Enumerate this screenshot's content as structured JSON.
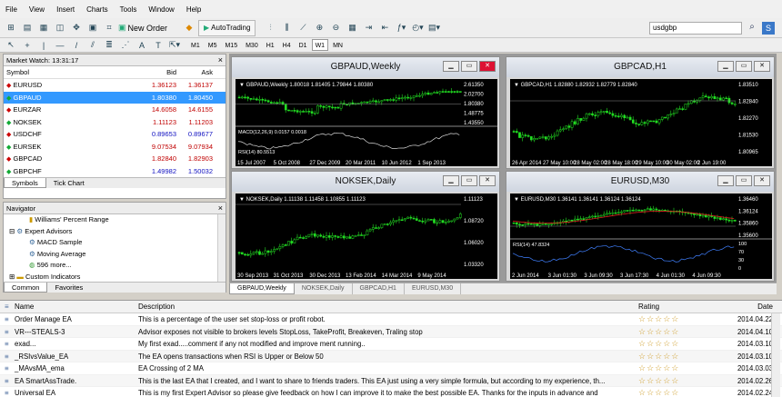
{
  "menu": [
    "File",
    "View",
    "Insert",
    "Charts",
    "Tools",
    "Window",
    "Help"
  ],
  "toolbar": {
    "new_order": "New Order",
    "autotrading": "AutoTrading",
    "search_value": "usdgbp"
  },
  "timeframes": [
    "M1",
    "M5",
    "M15",
    "M30",
    "H1",
    "H4",
    "D1",
    "W1",
    "MN"
  ],
  "market_watch": {
    "title": "Market Watch: 13:31:17",
    "cols": {
      "symbol": "Symbol",
      "bid": "Bid",
      "ask": "Ask"
    },
    "rows": [
      {
        "symbol": "EURUSD",
        "bid": "1.36123",
        "ask": "1.36137"
      },
      {
        "symbol": "GBPAUD",
        "bid": "1.80380",
        "ask": "1.80450"
      },
      {
        "symbol": "EURZAR",
        "bid": "14.6058",
        "ask": "14.6155"
      },
      {
        "symbol": "NOKSEK",
        "bid": "1.11123",
        "ask": "1.11203"
      },
      {
        "symbol": "USDCHF",
        "bid": "0.89653",
        "ask": "0.89677"
      },
      {
        "symbol": "EURSEK",
        "bid": "9.07534",
        "ask": "9.07934"
      },
      {
        "symbol": "GBPCAD",
        "bid": "1.82840",
        "ask": "1.82903"
      },
      {
        "symbol": "GBPCHF",
        "bid": "1.49982",
        "ask": "1.50032"
      }
    ],
    "tabs": [
      "Symbols",
      "Tick Chart"
    ]
  },
  "navigator": {
    "title": "Navigator",
    "items": [
      "Williams' Percent Range",
      "Expert Advisors",
      "MACD Sample",
      "Moving Average",
      "596 more...",
      "Custom Indicators"
    ],
    "tabs": [
      "Common",
      "Favorites"
    ]
  },
  "charts": [
    {
      "title": "GBPAUD,Weekly",
      "info": "GBPAUD,Weekly  1.80018 1.81405 1.79844 1.80380",
      "prices": [
        "2.61350",
        "2.02700",
        "1.80380",
        "1.48775",
        "1.43550"
      ],
      "dates": [
        "15 Jul 2007",
        "5 Oct 2008",
        "27 Dec 2009",
        "20 Mar 2011",
        "10 Jun 2012",
        "1 Sep 2013"
      ],
      "sub1": "MACD(12,26,9) 0.0157  0.0018",
      "sub2": "RSI(14) 80.5513"
    },
    {
      "title": "GBPCAD,H1",
      "info": "GBPCAD,H1  1.82880 1.82932 1.82779 1.82840",
      "prices": [
        "1.83510",
        "1.82840",
        "1.82270",
        "1.81530",
        "1.80965"
      ],
      "dates": [
        "26 Apr 2014",
        "27 May 10:00",
        "28 May 02:00",
        "28 May 18:00",
        "29 May 10:00",
        "30 May 02:00",
        "2 Jun 19:00"
      ]
    },
    {
      "title": "NOKSEK,Daily",
      "info": "NOKSEK,Daily  1.11138 1.11458 1.10855 1.11123",
      "prices": [
        "1.11123",
        "1.08720",
        "1.06020",
        "1.03320"
      ],
      "dates": [
        "30 Sep 2013",
        "31 Oct 2013",
        "30 Dec 2013",
        "13 Feb 2014",
        "14 Mar 2014",
        "9 May 2014"
      ]
    },
    {
      "title": "EURUSD,M30",
      "info": "EURUSD,M30  1.36141 1.36141 1.36124 1.36124",
      "prices": [
        "1.36460",
        "1.36124",
        "1.35860",
        "1.35600"
      ],
      "sub": "RSI(14) 47.8324",
      "subprices": [
        "100",
        "70",
        "30",
        "0"
      ],
      "dates": [
        "2 Jun 2014",
        "3 Jun 01:30",
        "3 Jun 09:30",
        "3 Jun 17:30",
        "4 Jun 01:30",
        "4 Jun 09:30"
      ]
    }
  ],
  "chart_tabs": [
    "GBPAUD,Weekly",
    "NOKSEK,Daily",
    "GBPCAD,H1",
    "EURUSD,M30"
  ],
  "market": {
    "cols": {
      "name": "Name",
      "desc": "Description",
      "rating": "Rating",
      "date": "Date"
    },
    "rows": [
      {
        "name": "Order Manage EA",
        "desc": "This is a percentage of the user set stop-loss or profit robot.",
        "date": "2014.04.22"
      },
      {
        "name": "VR---STEALS-3",
        "desc": "Advisor exposes not visible to brokers levels StopLoss, TakeProfit, Breakeven, Traling stop",
        "date": "2014.04.10"
      },
      {
        "name": "exad...",
        "desc": "My first exad.....comment if any not modified  and improve ment running..",
        "date": "2014.03.10"
      },
      {
        "name": "_RSIvsValue_EA",
        "desc": "The EA opens transactions when RSI is Upper or Below 50",
        "date": "2014.03.10"
      },
      {
        "name": "_MAvsMA_ema",
        "desc": "EA Crossing of 2 MA",
        "date": "2014.03.03"
      },
      {
        "name": "EA SmartAssTrade.",
        "desc": "This is the last EA that I created, and I want to share to friends traders. This EA just using a very simple formula, but according to my experience, th...",
        "date": "2014.02.26"
      },
      {
        "name": "Universal EA",
        "desc": "This is my first Expert Advisor so please give feedback on how I can improve it to make the best possible EA. Thanks for the inputs in advance and",
        "date": "2014.02.24"
      }
    ]
  }
}
